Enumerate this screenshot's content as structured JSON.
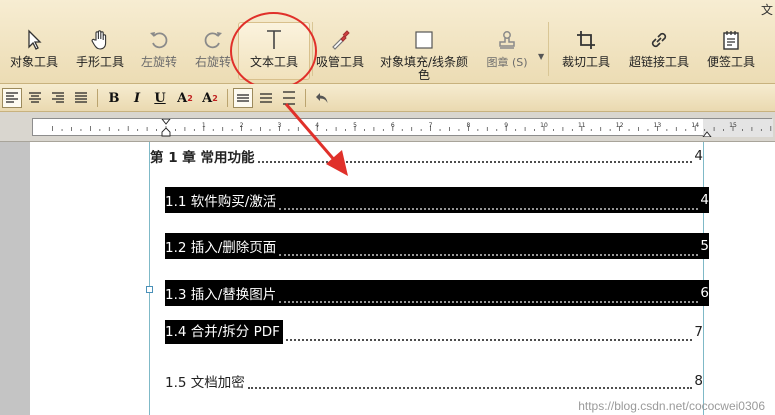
{
  "window": {
    "title_fragment": "文"
  },
  "toolbar": {
    "tools": [
      {
        "id": "select",
        "label": "对象工具"
      },
      {
        "id": "hand",
        "label": "手形工具"
      },
      {
        "id": "rotate-left",
        "label": "左旋转"
      },
      {
        "id": "rotate-right",
        "label": "右旋转"
      },
      {
        "id": "text",
        "label": "文本工具"
      },
      {
        "id": "eyedropper",
        "label": "吸管工具"
      },
      {
        "id": "fill",
        "label": "对象填充/线条颜",
        "label_line2": "色"
      },
      {
        "id": "stamp",
        "label": "图章 (S)"
      },
      {
        "id": "crop",
        "label": "裁切工具"
      },
      {
        "id": "link",
        "label": "超链接工具"
      },
      {
        "id": "note",
        "label": "便签工具"
      }
    ]
  },
  "format_bar": {
    "bold": "B",
    "italic": "I",
    "underline": "U",
    "superscript": "A",
    "superscript_mark": "2",
    "subscript": "A",
    "subscript_mark": "2"
  },
  "ruler": {
    "labels": [
      "1",
      "2",
      "3",
      "4",
      "5",
      "6",
      "7",
      "8",
      "9",
      "10",
      "11",
      "12",
      "13",
      "14",
      "15",
      "16"
    ]
  },
  "document": {
    "toc": [
      {
        "title": "第 1 章  常用功能",
        "page": "4",
        "selected": false
      },
      {
        "title": "1.1 软件购买/激活",
        "page": "4",
        "selected": true
      },
      {
        "title": "1.2 插入/删除页面",
        "page": "5",
        "selected": true
      },
      {
        "title": "1.3 插入/替换图片",
        "page": "6",
        "selected": true
      },
      {
        "title": "1.4 合并/拆分 PDF",
        "page": "7",
        "selected": "partial"
      },
      {
        "title": "1.5 文档加密",
        "page": "8",
        "selected": false
      }
    ]
  },
  "watermark": "https://blog.csdn.net/cococwei0306",
  "colors": {
    "annotation_red": "#e0302a",
    "ribbon": "#f2e4c0",
    "selection": "#000000"
  }
}
